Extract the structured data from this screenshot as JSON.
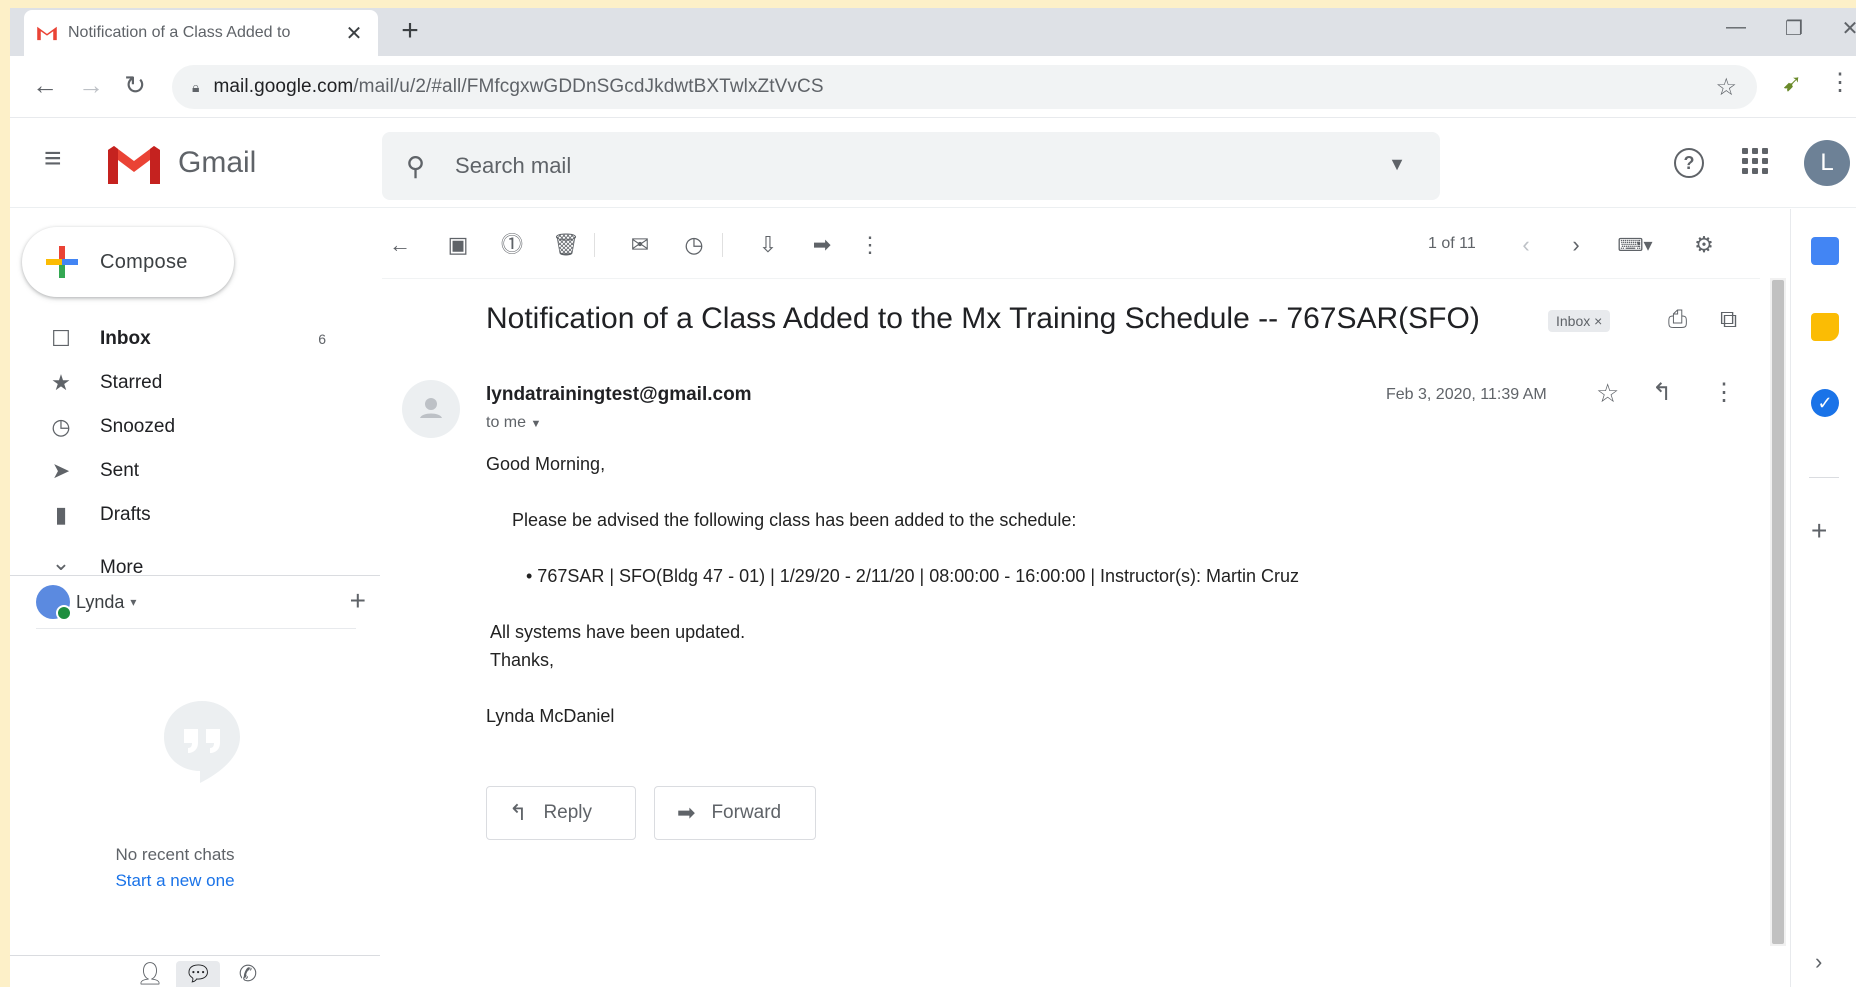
{
  "browser": {
    "tab_title": "Notification of a Class Added to",
    "tab_close": "✕",
    "new_tab": "+",
    "url_host": "mail.google.com",
    "url_path": "/mail/u/2/#all/FMfcgxwGDDnSGcdJkdwtBXTwlxZtVvCS"
  },
  "gmail": {
    "logo_text": "Gmail",
    "search_placeholder": "Search mail",
    "avatar_letter": "L"
  },
  "compose_label": "Compose",
  "nav": [
    {
      "label": "Inbox",
      "count": "6",
      "icon": "inbox-icon"
    },
    {
      "label": "Starred",
      "count": "",
      "icon": "star-icon"
    },
    {
      "label": "Snoozed",
      "count": "",
      "icon": "clock-icon"
    },
    {
      "label": "Sent",
      "count": "",
      "icon": "send-icon"
    },
    {
      "label": "Drafts",
      "count": "",
      "icon": "draft-icon"
    },
    {
      "label": "More",
      "count": "",
      "icon": "chevron-down-icon"
    }
  ],
  "hangouts": {
    "user_name": "Lynda",
    "no_chats": "No recent chats",
    "start_new": "Start a new one"
  },
  "toolbar": {
    "pager": "1 of 11"
  },
  "message": {
    "subject": "Notification of a Class Added to the Mx Training Schedule -- 767SAR(SFO)",
    "label_chip": "Inbox ×",
    "sender": "lyndatrainingtest@gmail.com",
    "to": "to me",
    "date": "Feb 3, 2020, 11:39 AM",
    "greeting": "Good Morning,",
    "advisory": "Please be advised the following class has been added to the schedule:",
    "class_line": "• 767SAR | SFO(Bldg 47 - 01) | 1/29/20 - 2/11/20 | 08:00:00 - 16:00:00 | Instructor(s): Martin Cruz",
    "updated": "All systems have been updated.",
    "thanks": "Thanks,",
    "signature": "Lynda McDaniel"
  },
  "actions": {
    "reply": "Reply",
    "forward": "Forward"
  },
  "colors": {
    "page_bg": "#fdf0c8",
    "gmail_red": "#ea4335",
    "link_blue": "#1a73e8",
    "avatar": "#6d8196"
  }
}
